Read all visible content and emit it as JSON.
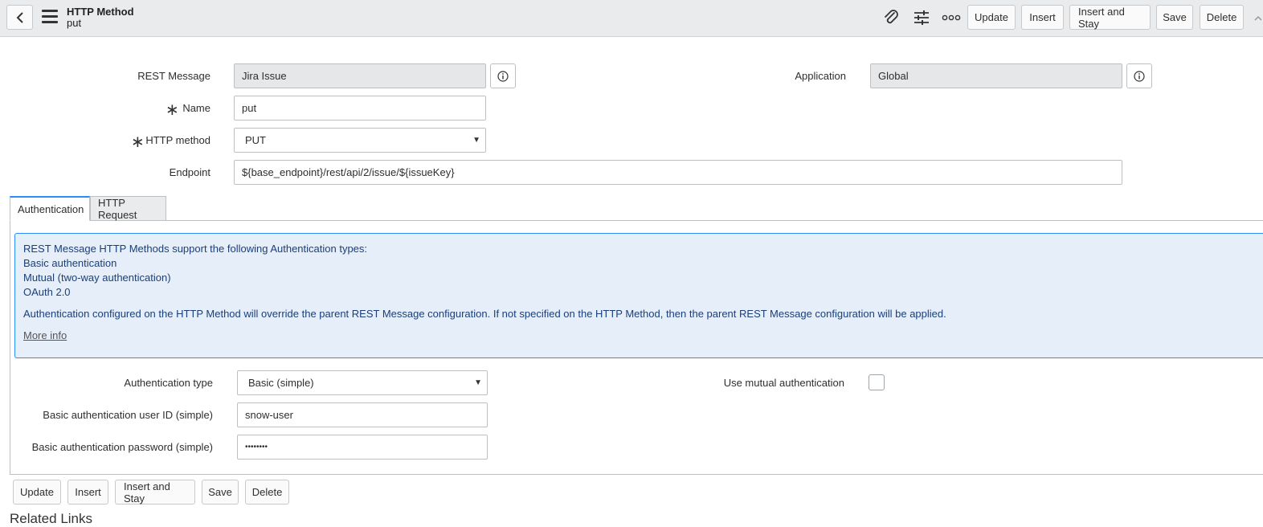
{
  "header": {
    "title": "HTTP Method",
    "subtitle": "put",
    "icons": [
      "back-icon",
      "menu-icon",
      "paperclip-icon",
      "sliders-icon",
      "more-icon"
    ],
    "buttons": {
      "update": "Update",
      "insert": "Insert",
      "insert_stay": "Insert and Stay",
      "save": "Save",
      "delete": "Delete"
    }
  },
  "form": {
    "rest_message": {
      "label": "REST Message",
      "value": "Jira Issue"
    },
    "name": {
      "label": "Name",
      "value": "put"
    },
    "http_method": {
      "label": "HTTP method",
      "value": "PUT"
    },
    "endpoint": {
      "label": "Endpoint",
      "value": "${base_endpoint}/rest/api/2/issue/${issueKey}"
    },
    "application": {
      "label": "Application",
      "value": "Global"
    },
    "required_marker": "∗"
  },
  "tabs": [
    {
      "label": "Authentication",
      "active": true
    },
    {
      "label": "HTTP Request",
      "active": false
    }
  ],
  "info": {
    "line1": "REST Message HTTP Methods support the following Authentication types:",
    "line2": "Basic authentication",
    "line3": "Mutual (two-way authentication)",
    "line4": "OAuth 2.0",
    "line5": "Authentication configured on the HTTP Method will override the parent REST Message configuration. If not specified on the HTTP Method, then the parent REST Message configuration will be applied.",
    "more_info": "More info",
    "accent": "#278efc",
    "background": "#e5eef9"
  },
  "auth": {
    "type": {
      "label": "Authentication type",
      "value": "Basic (simple)"
    },
    "user_id": {
      "label": "Basic authentication user ID (simple)",
      "value": "snow-user"
    },
    "password": {
      "label": "Basic authentication password (simple)",
      "value": "••••••••"
    },
    "mutual": {
      "label": "Use mutual authentication",
      "checked": false
    }
  },
  "footer": {
    "buttons": {
      "update": "Update",
      "insert": "Insert",
      "insert_stay": "Insert and Stay",
      "save": "Save",
      "delete": "Delete"
    },
    "related_links": "Related Links"
  }
}
